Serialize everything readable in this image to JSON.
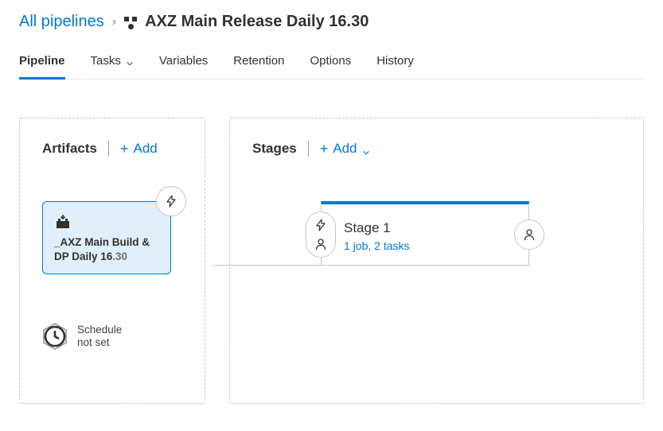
{
  "breadcrumb": {
    "root": "All pipelines",
    "title": "AXZ Main Release Daily 16.30"
  },
  "tabs": {
    "pipeline": "Pipeline",
    "tasks": "Tasks",
    "variables": "Variables",
    "retention": "Retention",
    "options": "Options",
    "history": "History"
  },
  "artifacts": {
    "heading": "Artifacts",
    "add_label": "Add",
    "card": {
      "name_prefix": "_AXZ Main Build & DP Daily 16",
      "name_suffix": ".30"
    },
    "schedule": {
      "line1": "Schedule",
      "line2": "not set"
    }
  },
  "stages": {
    "heading": "Stages",
    "add_label": "Add",
    "card": {
      "name": "Stage 1",
      "meta": "1 job, 2 tasks"
    }
  }
}
